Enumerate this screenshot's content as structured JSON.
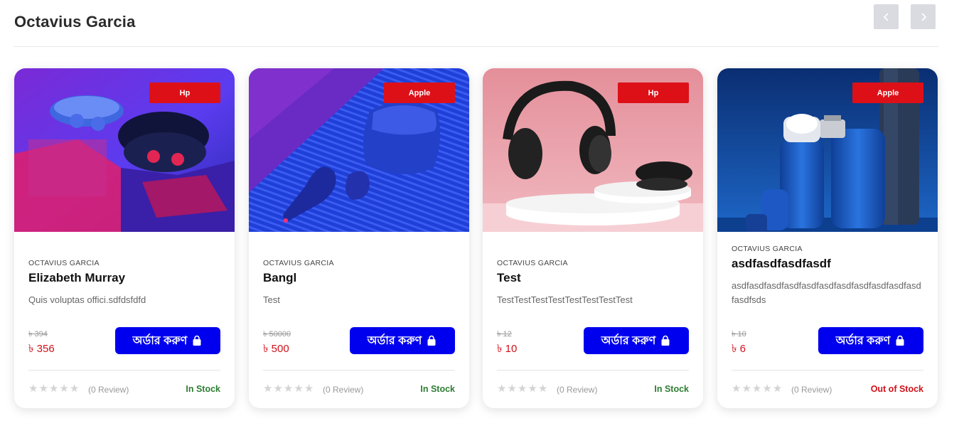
{
  "section": {
    "title": "Octavius Garcia"
  },
  "nav": {
    "prev_icon": "chevron-left-icon",
    "next_icon": "chevron-right-icon"
  },
  "colors": {
    "badge": "#dd1018",
    "order_button": "#0000ee",
    "price": "#d0121a",
    "in_stock": "#2e7d32",
    "out_of_stock": "#d0121a"
  },
  "products": [
    {
      "brand": "Hp",
      "seller": "OCTAVIUS GARCIA",
      "name": "Elizabeth Murray",
      "description": "Quis voluptas offici.sdfdsfdfd",
      "old_price": "৳ 394",
      "price": "৳ 356",
      "order_label": "অর্ডার করুণ",
      "rating_stars": 0,
      "reviews": "(0 Review)",
      "stock": "In Stock",
      "image": "earbuds-case"
    },
    {
      "brand": "Apple",
      "seller": "OCTAVIUS GARCIA",
      "name": "Bangl",
      "description": "Test",
      "old_price": "৳ 50000",
      "price": "৳ 500",
      "order_label": "অর্ডার করুণ",
      "rating_stars": 0,
      "reviews": "(0 Review)",
      "stock": "In Stock",
      "image": "airpods"
    },
    {
      "brand": "Hp",
      "seller": "OCTAVIUS GARCIA",
      "name": "Test",
      "description": "TestTestTestTestTestTestTestTest",
      "old_price": "৳ 12",
      "price": "৳ 10",
      "order_label": "অর্ডার করুণ",
      "rating_stars": 0,
      "reviews": "(0 Review)",
      "stock": "In Stock",
      "image": "headphones"
    },
    {
      "brand": "Apple",
      "seller": "OCTAVIUS GARCIA",
      "name": "asdfasdfasdfasdf",
      "description": "asdfasdfasdfasdfasdfasdfasdfasdfasdfasdfasdfasdfsds",
      "old_price": "৳ 10",
      "price": "৳ 6",
      "order_label": "অর্ডার করুণ",
      "rating_stars": 0,
      "reviews": "(0 Review)",
      "stock": "Out of Stock",
      "image": "cosmetics-bottles"
    }
  ]
}
